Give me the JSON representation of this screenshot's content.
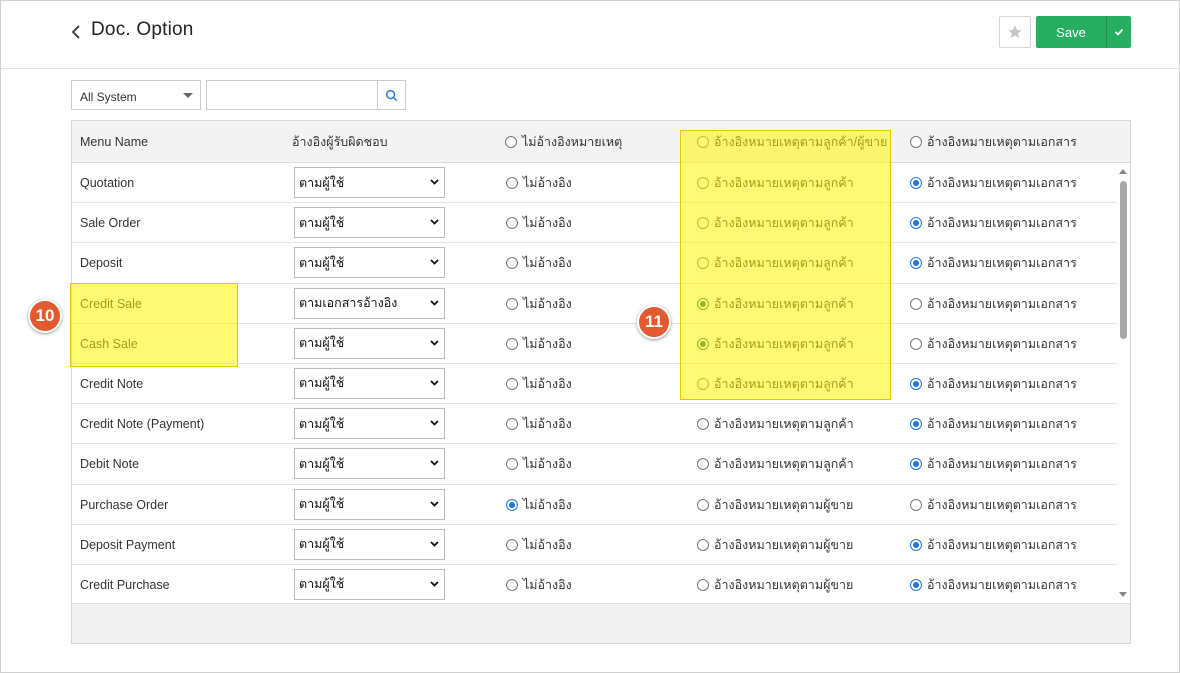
{
  "header": {
    "title": "Doc. Option",
    "save_label": "Save"
  },
  "filter": {
    "system_selected": "All System",
    "search_placeholder": ""
  },
  "table": {
    "columns": {
      "menu_name": "Menu Name",
      "responsible": "อ้างอิงผู้รับผิดชอบ",
      "no_ref": "ไม่อ้างอิงหมายเหตุ",
      "ref_partner": "อ้างอิงหมายเหตุตามลูกค้า/ผู้ขาย",
      "ref_doc": "อ้างอิงหมายเหตุตามเอกสาร"
    },
    "rows": [
      {
        "name": "Quotation",
        "responsible": "ตามผู้ใช้",
        "no_ref": "ไม่อ้างอิง",
        "partner": "อ้างอิงหมายเหตุตามลูกค้า",
        "doc": "อ้างอิงหมายเหตุตามเอกสาร",
        "selected": "doc"
      },
      {
        "name": "Sale Order",
        "responsible": "ตามผู้ใช้",
        "no_ref": "ไม่อ้างอิง",
        "partner": "อ้างอิงหมายเหตุตามลูกค้า",
        "doc": "อ้างอิงหมายเหตุตามเอกสาร",
        "selected": "doc"
      },
      {
        "name": "Deposit",
        "responsible": "ตามผู้ใช้",
        "no_ref": "ไม่อ้างอิง",
        "partner": "อ้างอิงหมายเหตุตามลูกค้า",
        "doc": "อ้างอิงหมายเหตุตามเอกสาร",
        "selected": "doc"
      },
      {
        "name": "Credit Sale",
        "responsible": "ตามเอกสารอ้างอิง",
        "no_ref": "ไม่อ้างอิง",
        "partner": "อ้างอิงหมายเหตุตามลูกค้า",
        "doc": "อ้างอิงหมายเหตุตามเอกสาร",
        "selected": "partner"
      },
      {
        "name": "Cash Sale",
        "responsible": "ตามผู้ใช้",
        "no_ref": "ไม่อ้างอิง",
        "partner": "อ้างอิงหมายเหตุตามลูกค้า",
        "doc": "อ้างอิงหมายเหตุตามเอกสาร",
        "selected": "partner"
      },
      {
        "name": "Credit Note",
        "responsible": "ตามผู้ใช้",
        "no_ref": "ไม่อ้างอิง",
        "partner": "อ้างอิงหมายเหตุตามลูกค้า",
        "doc": "อ้างอิงหมายเหตุตามเอกสาร",
        "selected": "doc"
      },
      {
        "name": "Credit Note (Payment)",
        "responsible": "ตามผู้ใช้",
        "no_ref": "ไม่อ้างอิง",
        "partner": "อ้างอิงหมายเหตุตามลูกค้า",
        "doc": "อ้างอิงหมายเหตุตามเอกสาร",
        "selected": "doc"
      },
      {
        "name": "Debit Note",
        "responsible": "ตามผู้ใช้",
        "no_ref": "ไม่อ้างอิง",
        "partner": "อ้างอิงหมายเหตุตามลูกค้า",
        "doc": "อ้างอิงหมายเหตุตามเอกสาร",
        "selected": "doc"
      },
      {
        "name": "Purchase Order",
        "responsible": "ตามผู้ใช้",
        "no_ref": "ไม่อ้างอิง",
        "partner": "อ้างอิงหมายเหตุตามผู้ขาย",
        "doc": "อ้างอิงหมายเหตุตามเอกสาร",
        "selected": "no_ref"
      },
      {
        "name": "Deposit Payment",
        "responsible": "ตามผู้ใช้",
        "no_ref": "ไม่อ้างอิง",
        "partner": "อ้างอิงหมายเหตุตามผู้ขาย",
        "doc": "อ้างอิงหมายเหตุตามเอกสาร",
        "selected": "doc"
      },
      {
        "name": "Credit Purchase",
        "responsible": "ตามผู้ใช้",
        "no_ref": "ไม่อ้างอิง",
        "partner": "อ้างอิงหมายเหตุตามผู้ขาย",
        "doc": "อ้างอิงหมายเหตุตามเอกสาร",
        "selected": "doc"
      }
    ]
  },
  "annotations": {
    "badge_left": "10",
    "badge_right": "11"
  },
  "colors": {
    "save_green": "#27ae60",
    "radio_blue": "#1a73e8",
    "radio_green": "#1f6f3a",
    "highlight_yellow": "#fff500",
    "badge_orange": "#e25a2e"
  },
  "icons": {
    "back": "chevron-left-icon",
    "favorite": "star-icon",
    "save_check": "check-icon",
    "search": "search-icon"
  }
}
